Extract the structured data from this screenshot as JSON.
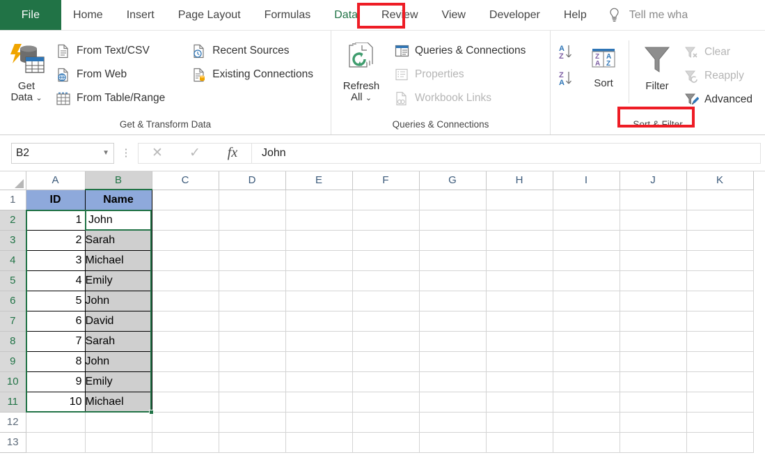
{
  "window": {
    "app": "Microsoft Excel"
  },
  "ribbon": {
    "file_tab": "File",
    "tabs": [
      {
        "label": "Home",
        "active": false
      },
      {
        "label": "Insert",
        "active": false
      },
      {
        "label": "Page Layout",
        "active": false
      },
      {
        "label": "Formulas",
        "active": false
      },
      {
        "label": "Data",
        "active": true
      },
      {
        "label": "Review",
        "active": false
      },
      {
        "label": "View",
        "active": false
      },
      {
        "label": "Developer",
        "active": false
      },
      {
        "label": "Help",
        "active": false
      }
    ],
    "tell_me": "Tell me wha",
    "groups": [
      {
        "label": "Get & Transform Data",
        "big_button": {
          "line1": "Get",
          "line2": "Data",
          "caret": "⌄"
        },
        "commands_col1": [
          {
            "label": "From Text/CSV",
            "disabled": false
          },
          {
            "label": "From Web",
            "disabled": false
          },
          {
            "label": "From Table/Range",
            "disabled": false
          }
        ],
        "commands_col2": [
          {
            "label": "Recent Sources",
            "disabled": false
          },
          {
            "label": "Existing Connections",
            "disabled": false
          }
        ]
      },
      {
        "label": "Queries & Connections",
        "big_button": {
          "line1": "Refresh",
          "line2": "All",
          "caret": "⌄"
        },
        "commands_col1": [
          {
            "label": "Queries & Connections",
            "disabled": false
          },
          {
            "label": "Properties",
            "disabled": true
          },
          {
            "label": "Workbook Links",
            "disabled": true
          }
        ]
      },
      {
        "label": "Sort & Filter",
        "sort_asc": "A↓Z",
        "sort_desc": "Z↓A",
        "sort_button": "Sort",
        "filter_button": "Filter",
        "commands_col1": [
          {
            "label": "Clear",
            "disabled": true
          },
          {
            "label": "Reapply",
            "disabled": true
          },
          {
            "label": "Advanced",
            "disabled": false
          }
        ]
      }
    ],
    "annotations": [
      {
        "target": "data-tab",
        "color": "#ee1c25"
      },
      {
        "target": "sort-and-filter-group-label",
        "color": "#ee1c25"
      }
    ]
  },
  "formula_bar": {
    "name_box_value": "B2",
    "cancel_icon": "✕",
    "enter_icon": "✓",
    "function_icon": "fx",
    "formula_value": "John"
  },
  "sheet": {
    "column_headers": [
      "A",
      "B",
      "C",
      "D",
      "E",
      "F",
      "G",
      "H",
      "I",
      "J",
      "K"
    ],
    "selected_column": "B",
    "row_headers": [
      "1",
      "2",
      "3",
      "4",
      "5",
      "6",
      "7",
      "8",
      "9",
      "10",
      "11",
      "12",
      "13"
    ],
    "selected_rows": [
      "2",
      "3",
      "4",
      "5",
      "6",
      "7",
      "8",
      "9",
      "10",
      "11"
    ],
    "table_headers": {
      "A1": "ID",
      "B1": "Name"
    },
    "rows": [
      {
        "row": "2",
        "id": "1",
        "name": "John"
      },
      {
        "row": "3",
        "id": "2",
        "name": "Sarah"
      },
      {
        "row": "4",
        "id": "3",
        "name": "Michael"
      },
      {
        "row": "5",
        "id": "4",
        "name": "Emily"
      },
      {
        "row": "6",
        "id": "5",
        "name": "John"
      },
      {
        "row": "7",
        "id": "6",
        "name": "David"
      },
      {
        "row": "8",
        "id": "7",
        "name": "Sarah"
      },
      {
        "row": "9",
        "id": "8",
        "name": "John"
      },
      {
        "row": "10",
        "id": "9",
        "name": "Emily"
      },
      {
        "row": "11",
        "id": "10",
        "name": "Michael"
      }
    ],
    "empty_rows": [
      "12",
      "13"
    ],
    "active_cell": {
      "ref": "B2",
      "value": "John"
    },
    "selection_range": "A2:B11"
  },
  "colors": {
    "excel_green": "#217346",
    "header_fill": "#8ea9db",
    "selection_fill": "#cfcfcf",
    "annotation_red": "#ee1c25"
  }
}
